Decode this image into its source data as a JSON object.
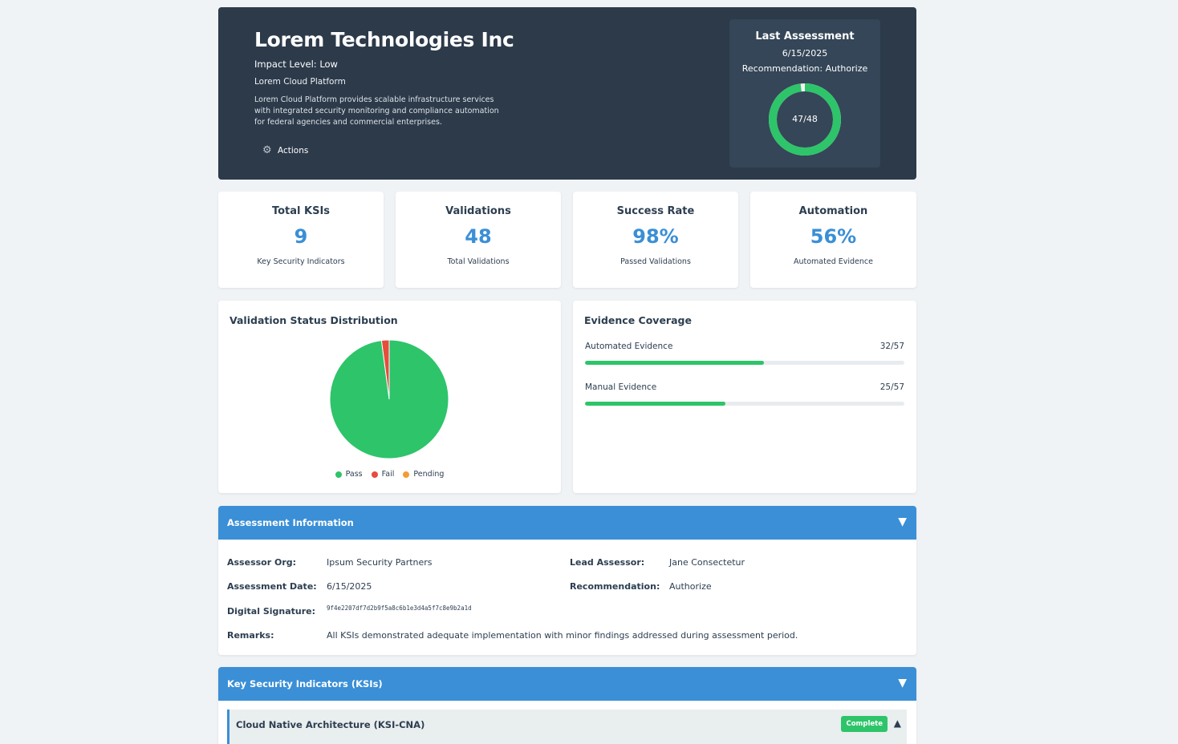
{
  "header": {
    "company": "Lorem Technologies Inc",
    "impact_level": "Impact Level: Low",
    "platform": "Lorem Cloud Platform",
    "description": "Lorem Cloud Platform provides scalable infrastructure services with integrated security monitoring and compliance automation for federal agencies and commercial enterprises.",
    "actions_label": "Actions",
    "actions_icon": "gear-icon"
  },
  "last_assessment": {
    "title": "Last Assessment",
    "date": "6/15/2025",
    "recommendation": "Recommendation: Authorize",
    "score_label": "47/48",
    "passed": 47,
    "total": 48
  },
  "stats": [
    {
      "title": "Total KSIs",
      "value": "9",
      "sub": "Key Security Indicators"
    },
    {
      "title": "Validations",
      "value": "48",
      "sub": "Total Validations"
    },
    {
      "title": "Success Rate",
      "value": "98%",
      "sub": "Passed Validations"
    },
    {
      "title": "Automation",
      "value": "56%",
      "sub": "Automated Evidence"
    }
  ],
  "status_chart": {
    "title": "Validation Status Distribution",
    "legend": [
      {
        "label": "Pass",
        "color": "#2ec46a"
      },
      {
        "label": "Fail",
        "color": "#e74c3c"
      },
      {
        "label": "Pending",
        "color": "#f39c34"
      }
    ]
  },
  "chart_data": {
    "type": "pie",
    "categories": [
      "Pass",
      "Fail",
      "Pending"
    ],
    "values": [
      47,
      1,
      0
    ],
    "colors": [
      "#2ec46a",
      "#e74c3c",
      "#f39c34"
    ]
  },
  "evidence": {
    "title": "Evidence Coverage",
    "rows": [
      {
        "label": "Automated Evidence",
        "count": "32/57",
        "fraction": 0.5614
      },
      {
        "label": "Manual Evidence",
        "count": "25/57",
        "fraction": 0.4386
      }
    ]
  },
  "assessment_info": {
    "title": "Assessment Information",
    "toggle": "▼",
    "assessor_org_label": "Assessor Org:",
    "assessor_org": "Ipsum Security Partners",
    "lead_assessor_label": "Lead Assessor:",
    "lead_assessor": "Jane Consectetur",
    "date_label": "Assessment Date:",
    "date": "6/15/2025",
    "recommendation_label": "Recommendation:",
    "recommendation": "Authorize",
    "signature_label": "Digital Signature:",
    "signature": "9f4e2207df7d2b9f5a8c6b1e3d4a5f7c8e9b2a1d",
    "remarks_label": "Remarks:",
    "remarks": "All KSIs demonstrated adequate implementation with minor findings addressed during assessment period."
  },
  "ksis": {
    "title": "Key Security Indicators (KSIs)",
    "toggle": "▼",
    "items": [
      {
        "name": "Cloud Native Architecture (KSI-CNA)",
        "status": "Complete",
        "toggle": "▲"
      }
    ]
  },
  "colors": {
    "header_bg": "#2c3a4a",
    "accent": "#3a8fd6",
    "success": "#2ec46a",
    "fail": "#e74c3c",
    "pending": "#f39c34"
  }
}
